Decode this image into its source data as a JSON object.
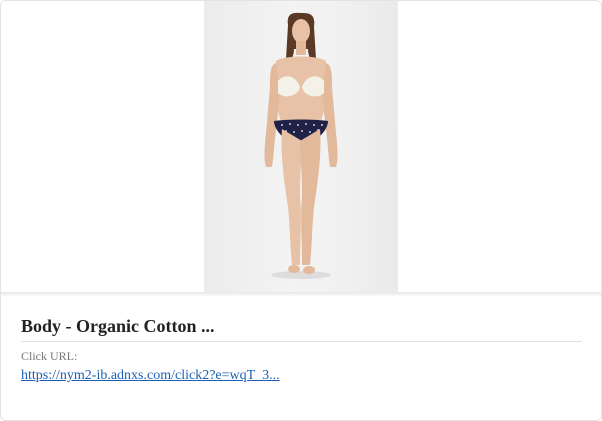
{
  "card": {
    "title": "Body - Organic Cotton ...",
    "click_label": "Click URL:",
    "click_url": "https://nym2-ib.adnxs.com/click2?e=wqT_3..."
  },
  "image": {
    "name": "product-photo-model-lingerie",
    "alt": "Model wearing white bra and navy polka dot briefs"
  },
  "colors": {
    "link": "#1a5fb4",
    "title": "#222222",
    "label": "#777777",
    "image_bg": "#f0f0f0",
    "garment_top": "#f4f1e8",
    "garment_bottom": "#1f2146"
  }
}
